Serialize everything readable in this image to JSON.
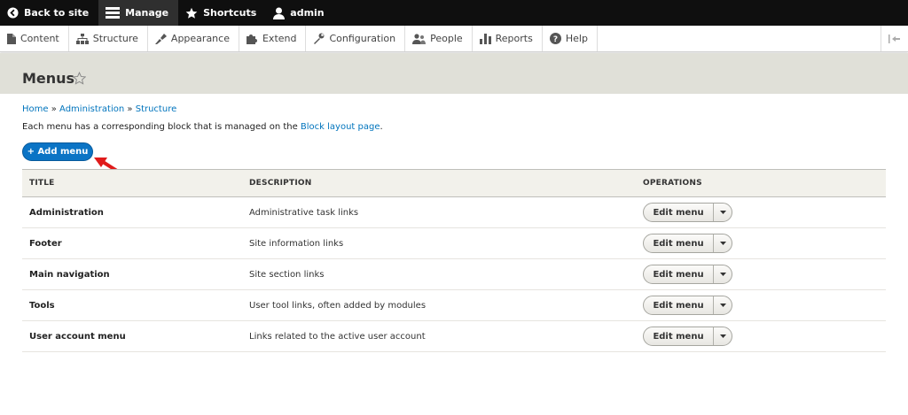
{
  "toolbar": {
    "back_label": "Back to site",
    "manage_label": "Manage",
    "shortcuts_label": "Shortcuts",
    "user_label": "admin"
  },
  "tray": {
    "items": [
      {
        "label": "Content",
        "icon": "document-icon"
      },
      {
        "label": "Structure",
        "icon": "sitemap-icon"
      },
      {
        "label": "Appearance",
        "icon": "brush-icon"
      },
      {
        "label": "Extend",
        "icon": "puzzle-icon"
      },
      {
        "label": "Configuration",
        "icon": "wrench-icon"
      },
      {
        "label": "People",
        "icon": "people-icon"
      },
      {
        "label": "Reports",
        "icon": "bar-chart-icon"
      },
      {
        "label": "Help",
        "icon": "help-icon"
      }
    ]
  },
  "page": {
    "title": "Menus",
    "breadcrumb": [
      "Home",
      "Administration",
      "Structure"
    ],
    "breadcrumb_sep": "»",
    "description_prefix": "Each menu has a corresponding block that is managed on the ",
    "description_link": "Block layout page",
    "description_suffix": ".",
    "add_button": "+ Add menu"
  },
  "table": {
    "headers": [
      "TITLE",
      "DESCRIPTION",
      "OPERATIONS"
    ],
    "rows": [
      {
        "title": "Administration",
        "description": "Administrative task links",
        "operation": "Edit menu"
      },
      {
        "title": "Footer",
        "description": "Site information links",
        "operation": "Edit menu"
      },
      {
        "title": "Main navigation",
        "description": "Site section links",
        "operation": "Edit menu"
      },
      {
        "title": "Tools",
        "description": "User tool links, often added by modules",
        "operation": "Edit menu"
      },
      {
        "title": "User account menu",
        "description": "Links related to the active user account",
        "operation": "Edit menu"
      }
    ]
  },
  "colors": {
    "link": "#0074bd",
    "primary_button": "#0b74c5",
    "toolbar_bg": "#0f0f0f",
    "header_bg": "#e0e0d8",
    "annotation_arrow": "#e01b1b"
  }
}
